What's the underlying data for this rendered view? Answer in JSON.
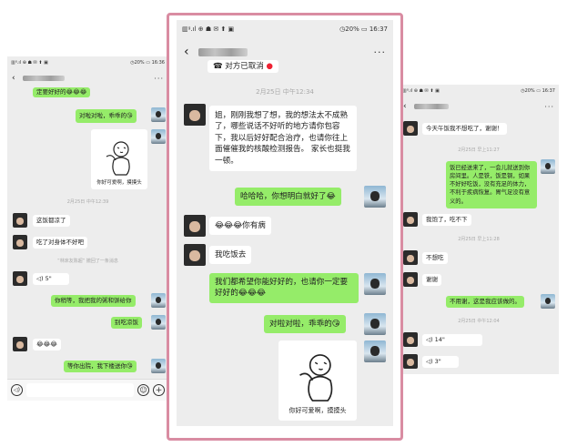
{
  "left_screen": {
    "status_left": "▥ᵍ.ıl ⊕ ☗ ✉ ⬆ ▣",
    "status_right": "◷20% ▭ 16:36",
    "more": "···",
    "messages": {
      "m1": "定要好好的😂😂😂",
      "m2": "对啦对啦，乖乖的😘",
      "sticker_caption": "你好可爱啊，摸摸头",
      "ts1": "2月25日 中午12:39",
      "m3": "这饭都凉了",
      "m4": "吃了对身体不好吧",
      "system": "“林床友陈超” 撤回了一条消息",
      "voice": "5\"",
      "m5": "你稍等，我把我的粥和饼给你",
      "m6": "别吃凉饭",
      "m7": "😂😂😂",
      "m8": "等你出院，我下楼送你😘"
    }
  },
  "center_screen": {
    "status_left": "▥ᵍ.ıl ⊕ ☗ ✉ ⬆ ▣",
    "status_right": "◷20% ▭ 16:37",
    "more": "···",
    "messages": {
      "m0": "对方已取消",
      "ts1": "2月25日 中午12:34",
      "m1": "姐，刚刚我想了想，我的想法太不成熟了，哪些说话不好听的地方请你包容下，我以后好好配合治疗，也请你往上面催催我的核酸检测报告。 家长也挺我一顿。",
      "m2": "哈哈哈，你想明白就好了😂",
      "m3": "😂😂😂你有病",
      "m4": "我吃饭去",
      "m5": "我们都希望你能好好的，也请你一定要好好的😂😂😂",
      "m6": "对啦对啦，乖乖的😘",
      "sticker_caption": "你好可爱啊，摸摸头"
    }
  },
  "right_screen": {
    "status_left": "▥ᵍ.ıl ⊕ ☗ ✉ ⬆ ▣",
    "status_right": "◷20% ▭ 16:37",
    "more": "···",
    "messages": {
      "m1": "今天午饭我不想吃了，谢谢！",
      "ts1": "2月25日 早上11:27",
      "m2": "饭已经送来了，一会儿就送到你房间里。人是铁，饭是钢，如果不好好吃饭，没有充足的体力，不利于疾病恢复。胃气足没有意义的。",
      "m3": "我饱了，吃不下",
      "ts2": "2月25日 早上11:28",
      "m4": "不想吃",
      "m5": "谢谢",
      "m6": "不用谢，这是我应该做的。",
      "ts3": "2月25日 中午12:04",
      "voice1": "14\"",
      "voice2": "3\""
    }
  },
  "colors": {
    "frame_border": "#d98ca2",
    "my_bubble": "#95ec69",
    "chat_bg": "#ededed"
  }
}
